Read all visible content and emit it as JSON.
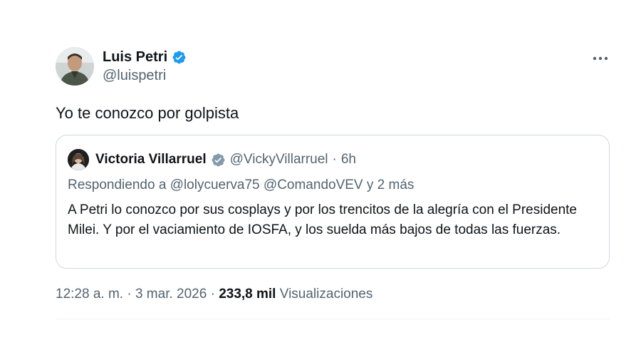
{
  "author": {
    "name": "Luis Petri",
    "handle": "@luispetri",
    "verified_color": "#1d9bf0"
  },
  "tweet": {
    "text": "Yo te conozco por golpista"
  },
  "quote": {
    "name": "Victoria Villarruel",
    "handle": "@VickyVillarruel",
    "separator": "·",
    "time": "6h",
    "reply_to": "Respondiendo a @lolycuerva75 @ComandoVEV y 2 más",
    "text": "A Petri lo conozco por sus cosplays y por los trencitos de la alegría con el Presidente Milei. Y por el vaciamiento de IOSFA, y los suelda más bajos de todas las fuerzas."
  },
  "meta": {
    "time": "12:28 a. m.",
    "sep1": "·",
    "date": "3 mar. 2026",
    "sep2": "·",
    "views_count": "233,8 mil",
    "views_label": "Visualizaciones"
  },
  "icons": {
    "verified": "verified-badge-icon",
    "more": "more-options-icon"
  }
}
